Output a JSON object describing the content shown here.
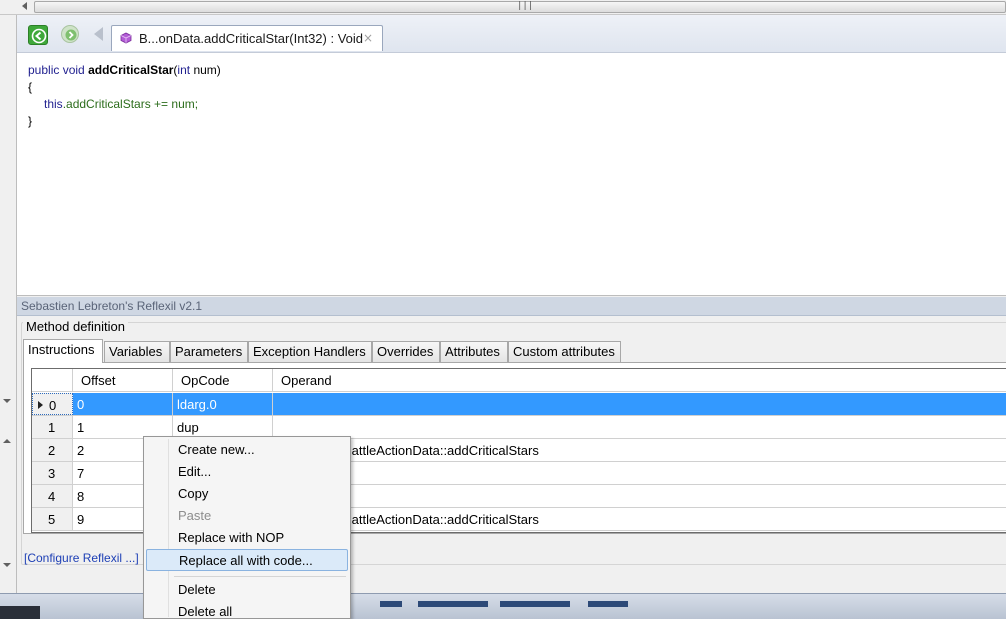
{
  "document_tab": {
    "label": "B...onData.addCriticalStar(Int32) : Void",
    "close": "×"
  },
  "code": {
    "line1": {
      "kw1": "public",
      "kw2": "void",
      "method": "addCriticalStar",
      "lparen": "(",
      "ptype": "int",
      "pname": "num",
      "rparen": ")"
    },
    "line2": "{",
    "line3": {
      "kw": "this",
      "rest": ".addCriticalStars += num;"
    },
    "line4": "}"
  },
  "reflexil": {
    "title": "Sebastien Lebreton's Reflexil v2.1",
    "group_label": "Method definition",
    "tabs": [
      "Instructions",
      "Variables",
      "Parameters",
      "Exception Handlers",
      "Overrides",
      "Attributes",
      "Custom attributes"
    ],
    "active_tab": "Instructions",
    "columns": [
      "Offset",
      "OpCode",
      "Operand"
    ],
    "rows": [
      {
        "index": "0",
        "offset": "0",
        "opcode": "ldarg.0",
        "operand": ""
      },
      {
        "index": "1",
        "offset": "1",
        "opcode": "dup",
        "operand": ""
      },
      {
        "index": "2",
        "offset": "2",
        "opcode": "",
        "operand": "BattleActionData::addCriticalStars"
      },
      {
        "index": "3",
        "offset": "7",
        "opcode": "",
        "operand": ""
      },
      {
        "index": "4",
        "offset": "8",
        "opcode": "",
        "operand": ""
      },
      {
        "index": "5",
        "offset": "9",
        "opcode": "",
        "operand": "BattleActionData::addCriticalStars"
      }
    ],
    "selected_row": 0,
    "configure_link": "[Configure Reflexil ...]"
  },
  "context_menu": {
    "items": [
      "Create new...",
      "Edit...",
      "Copy",
      "Paste",
      "Replace with NOP",
      "Replace all with code...",
      "Delete",
      "Delete all"
    ],
    "disabled": [
      "Paste"
    ],
    "highlighted": "Replace all with code..."
  },
  "icons": {
    "back": "green-back-arrow-icon",
    "forward": "green-forward-arrow-icon",
    "tab_method": "purple-method-icon"
  },
  "colors": {
    "selection": "#3399ff",
    "keyword": "#1f1f8f",
    "identifier_green": "#2c6d1c",
    "menu_highlight": "#dbeaf9"
  }
}
